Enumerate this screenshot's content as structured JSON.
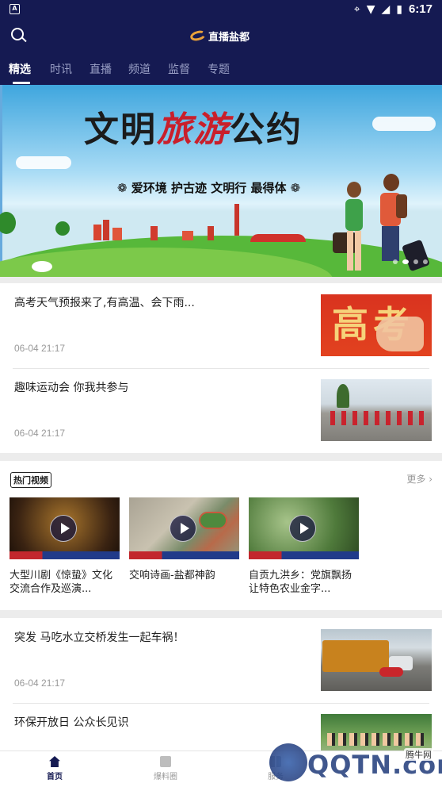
{
  "status_bar": {
    "app_indicator": "A",
    "time": "6:17"
  },
  "header": {
    "logo_text": "直播盐都",
    "tabs": [
      "精选",
      "时讯",
      "直播",
      "频道",
      "监督",
      "专题"
    ],
    "active_tab": 0
  },
  "banner": {
    "headline_prefix": "文明",
    "headline_highlight": "旅游",
    "headline_suffix": "公约",
    "slogan": "❁ 爱环境 护古迹 文明行 最得体 ❁"
  },
  "news_top": [
    {
      "title": "高考天气预报来了,有高温、会下雨...",
      "time": "06-04 21:17",
      "thumb": "高考"
    },
    {
      "title": "趣味运动会 你我共参与",
      "time": "06-04 21:17"
    }
  ],
  "hot_video": {
    "tag": "热门视频",
    "more": "更多",
    "items": [
      {
        "title": "大型川剧《惊蛰》文化交流合作及巡演..."
      },
      {
        "title": "交响诗画-盐都神韵"
      },
      {
        "title": "自贡九洪乡：党旗飘扬让特色农业金字..."
      }
    ]
  },
  "news_bottom": [
    {
      "title": "突发 马吃水立交桥发生一起车祸！",
      "time": "06-04 21:17"
    },
    {
      "title": "环保开放日 公众长见识"
    }
  ],
  "bottom_nav": {
    "items": [
      "首页",
      "爆料圈",
      "服务"
    ],
    "active": 0
  },
  "watermark": {
    "brand": "QQTN.com",
    "site": "腾牛网"
  },
  "colors": {
    "primary": "#151a52",
    "accent": "#e9a13a"
  }
}
